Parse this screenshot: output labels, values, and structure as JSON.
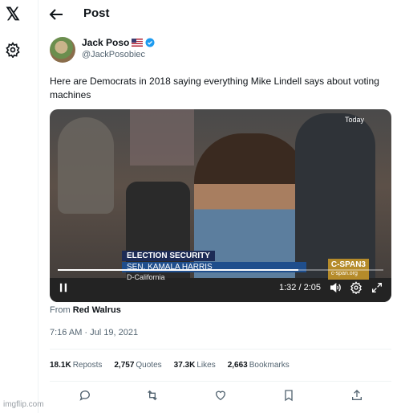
{
  "nav": {
    "logo_icon": "x-logo-icon",
    "settings_icon": "gear-icon"
  },
  "header": {
    "title": "Post",
    "back_icon": "arrow-left-icon"
  },
  "post": {
    "author_name": "Jack Poso",
    "author_handle": "@JackPosobiec",
    "text": "Here are Democrats in 2018 saying everything Mike Lindell says about voting machines",
    "media": {
      "today_label": "Today",
      "lower_third_top": "ELECTION SECURITY",
      "lower_third_name": "SEN. KAMALA HARRIS",
      "lower_third_sub": "D-California",
      "network": "C-SPAN3",
      "network_url": "c-span.org",
      "time": "1:32 / 2:05",
      "progress": 0.74
    },
    "from_label": "From",
    "from_source": "Red Walrus",
    "timestamp": "7:16 AM · Jul 19, 2021",
    "stats": [
      {
        "value": "18.1K",
        "label": "Reposts"
      },
      {
        "value": "2,757",
        "label": "Quotes"
      },
      {
        "value": "37.3K",
        "label": "Likes"
      },
      {
        "value": "2,663",
        "label": "Bookmarks"
      }
    ]
  },
  "watermark": "imgflip.com",
  "colors": {
    "accent": "#1d9bf0",
    "muted": "#536471",
    "border": "#eff3f4"
  }
}
